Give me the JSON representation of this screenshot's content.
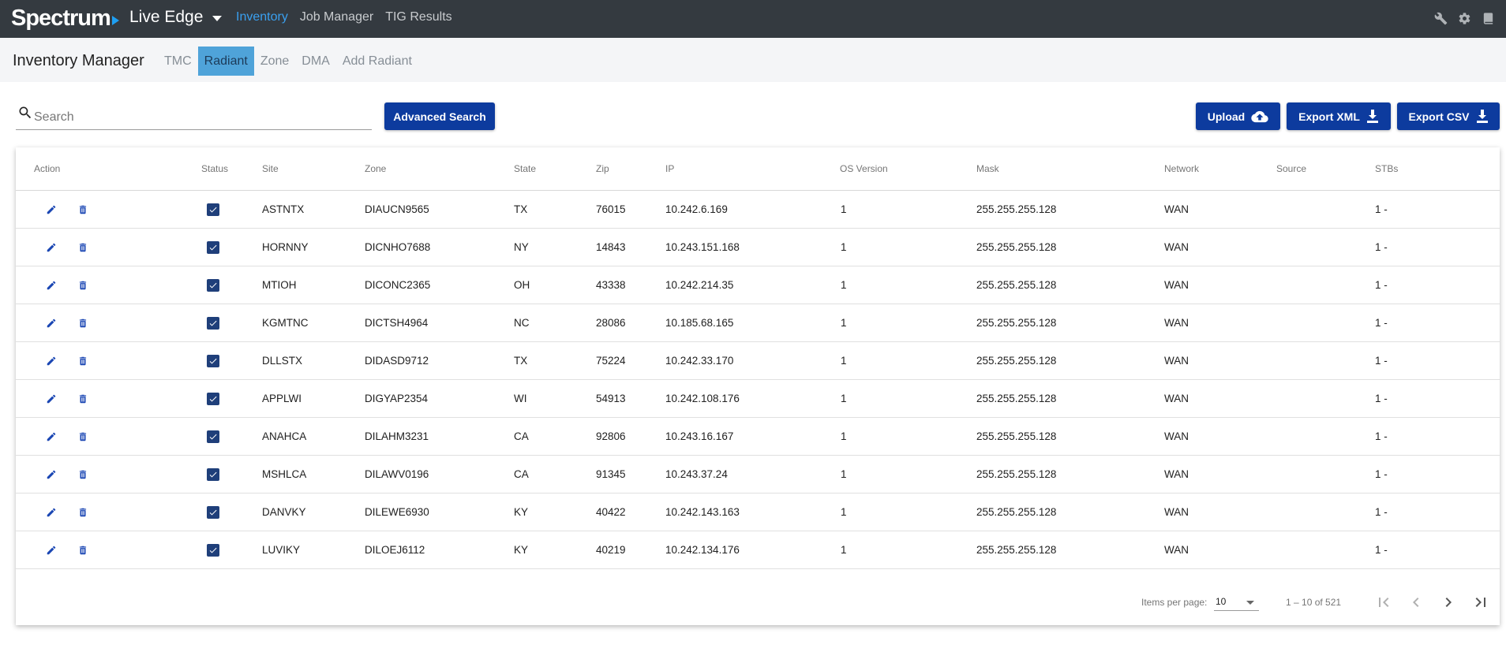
{
  "app": {
    "brand": "Spectrum",
    "environment": "Live Edge",
    "nav": [
      "Inventory",
      "Job Manager",
      "TIG Results"
    ],
    "active_nav": 0,
    "icons": [
      "wrench-icon",
      "gear-icon",
      "book-icon"
    ]
  },
  "subheader": {
    "title": "Inventory Manager",
    "tabs": [
      "TMC",
      "Radiant",
      "Zone",
      "DMA",
      "Add Radiant"
    ],
    "active_tab": 1
  },
  "search": {
    "placeholder": "Search",
    "value": "",
    "advanced_label": "Advanced Search"
  },
  "actions": {
    "upload_label": "Upload",
    "export_xml_label": "Export XML",
    "export_csv_label": "Export CSV"
  },
  "table": {
    "columns": [
      "Action",
      "Status",
      "Site",
      "Zone",
      "State",
      "Zip",
      "IP",
      "OS Version",
      "Mask",
      "Network",
      "Source",
      "STBs"
    ],
    "rows": [
      {
        "status": true,
        "site": "ASTNTX",
        "zone": "DIAUCN9565",
        "state": "TX",
        "zip": "76015",
        "ip": "10.242.6.169",
        "os": "1",
        "mask": "255.255.255.128",
        "network": "WAN",
        "source": "",
        "stbs": "1 -"
      },
      {
        "status": true,
        "site": "HORNNY",
        "zone": "DICNHO7688",
        "state": "NY",
        "zip": "14843",
        "ip": "10.243.151.168",
        "os": "1",
        "mask": "255.255.255.128",
        "network": "WAN",
        "source": "",
        "stbs": "1 -"
      },
      {
        "status": true,
        "site": "MTIOH",
        "zone": "DICONC2365",
        "state": "OH",
        "zip": "43338",
        "ip": "10.242.214.35",
        "os": "1",
        "mask": "255.255.255.128",
        "network": "WAN",
        "source": "",
        "stbs": "1 -"
      },
      {
        "status": true,
        "site": "KGMTNC",
        "zone": "DICTSH4964",
        "state": "NC",
        "zip": "28086",
        "ip": "10.185.68.165",
        "os": "1",
        "mask": "255.255.255.128",
        "network": "WAN",
        "source": "",
        "stbs": "1 -"
      },
      {
        "status": true,
        "site": "DLLSTX",
        "zone": "DIDASD9712",
        "state": "TX",
        "zip": "75224",
        "ip": "10.242.33.170",
        "os": "1",
        "mask": "255.255.255.128",
        "network": "WAN",
        "source": "",
        "stbs": "1 -"
      },
      {
        "status": true,
        "site": "APPLWI",
        "zone": "DIGYAP2354",
        "state": "WI",
        "zip": "54913",
        "ip": "10.242.108.176",
        "os": "1",
        "mask": "255.255.255.128",
        "network": "WAN",
        "source": "",
        "stbs": "1 -"
      },
      {
        "status": true,
        "site": "ANAHCA",
        "zone": "DILAHM3231",
        "state": "CA",
        "zip": "92806",
        "ip": "10.243.16.167",
        "os": "1",
        "mask": "255.255.255.128",
        "network": "WAN",
        "source": "",
        "stbs": "1 -"
      },
      {
        "status": true,
        "site": "MSHLCA",
        "zone": "DILAWV0196",
        "state": "CA",
        "zip": "91345",
        "ip": "10.243.37.24",
        "os": "1",
        "mask": "255.255.255.128",
        "network": "WAN",
        "source": "",
        "stbs": "1 -"
      },
      {
        "status": true,
        "site": "DANVKY",
        "zone": "DILEWE6930",
        "state": "KY",
        "zip": "40422",
        "ip": "10.242.143.163",
        "os": "1",
        "mask": "255.255.255.128",
        "network": "WAN",
        "source": "",
        "stbs": "1 -"
      },
      {
        "status": true,
        "site": "LUVIKY",
        "zone": "DILOEJ6112",
        "state": "KY",
        "zip": "40219",
        "ip": "10.242.134.176",
        "os": "1",
        "mask": "255.255.255.128",
        "network": "WAN",
        "source": "",
        "stbs": "1 -"
      }
    ]
  },
  "paginator": {
    "items_per_page_label": "Items per page:",
    "items_per_page": "10",
    "range": "1 – 10 of 521"
  },
  "colors": {
    "topbar": "#343a40",
    "accent": "#3aa0f0",
    "button": "#0d3b9e",
    "active_tab": "#4fa3d9"
  }
}
